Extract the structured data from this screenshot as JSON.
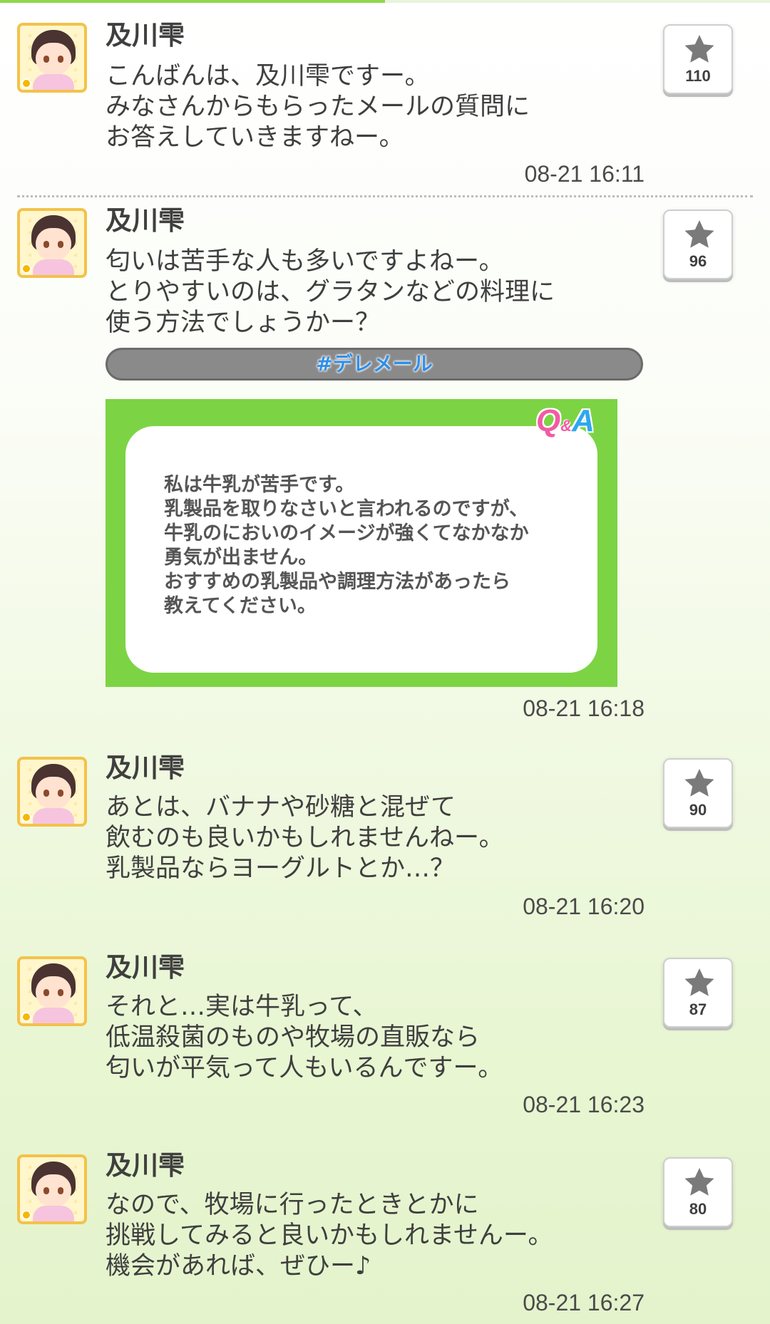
{
  "progress": 0.5,
  "posts": [
    {
      "name": "及川雫",
      "message": "こんばんは、及川雫ですー。\nみなさんからもらったメールの質問に\nお答えしていきますねー。",
      "time": "08-21 16:11",
      "stars": "110"
    },
    {
      "name": "及川雫",
      "message": "匂いは苦手な人も多いですよねー。\nとりやすいのは、グラタンなどの料理に\n使う方法でしょうかー？",
      "hashtag": "#デレメール",
      "qa_logo": {
        "q": "Q",
        "amp": "&",
        "a": "A"
      },
      "qa_text": "私は牛乳が苦手です。\n乳製品を取りなさいと言われるのですが、\n牛乳のにおいのイメージが強くてなかなか\n勇気が出ません。\nおすすめの乳製品や調理方法があったら\n教えてください。",
      "time": "08-21 16:18",
      "stars": "96"
    },
    {
      "name": "及川雫",
      "message": "あとは、バナナや砂糖と混ぜて\n飲むのも良いかもしれませんねー。\n乳製品ならヨーグルトとか…？",
      "time": "08-21 16:20",
      "stars": "90"
    },
    {
      "name": "及川雫",
      "message": "それと…実は牛乳って、\n低温殺菌のものや牧場の直販なら\n匂いが平気って人もいるんですー。",
      "time": "08-21 16:23",
      "stars": "87"
    },
    {
      "name": "及川雫",
      "message": "なので、牧場に行ったときとかに\n挑戦してみると良いかもしれませんー。\n機会があれば、ぜひー♪",
      "time": "08-21 16:27",
      "stars": "80"
    }
  ],
  "icons": {
    "star": "star-icon",
    "avatar": "idol-avatar"
  },
  "colors": {
    "accent_green": "#7cd444",
    "avatar_border": "#f3c24a",
    "hashtag_text": "#2e8fe8"
  }
}
